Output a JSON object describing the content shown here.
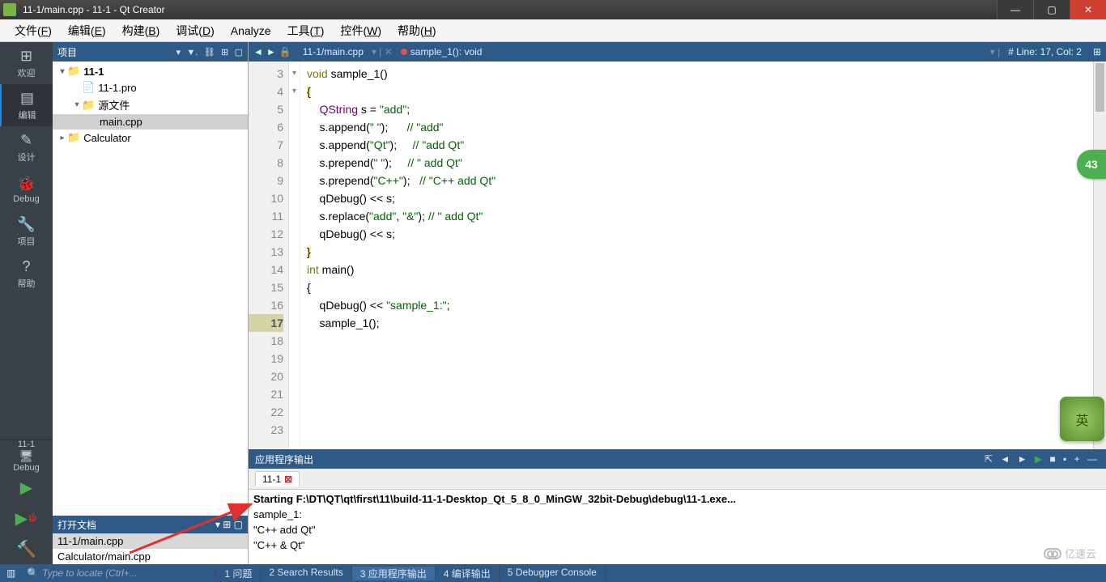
{
  "window": {
    "title": "11-1/main.cpp - 11-1 - Qt Creator"
  },
  "menus": [
    "文件(F)",
    "编辑(E)",
    "构建(B)",
    "调试(D)",
    "Analyze",
    "工具(T)",
    "控件(W)",
    "帮助(H)"
  ],
  "leftbar": {
    "items": [
      {
        "icon": "⊞",
        "label": "欢迎"
      },
      {
        "icon": "▤",
        "label": "编辑",
        "active": true
      },
      {
        "icon": "✎",
        "label": "设计"
      },
      {
        "icon": "🐞",
        "label": "Debug"
      },
      {
        "icon": "🔧",
        "label": "项目"
      },
      {
        "icon": "?",
        "label": "帮助"
      }
    ],
    "kit": {
      "name": "11-1",
      "mode": "Debug",
      "monitor": "🖥"
    }
  },
  "project_pane": {
    "title": "项目",
    "tree": [
      {
        "indent": 0,
        "arrow": "▾",
        "icon": "📁",
        "label": "11-1",
        "bold": true
      },
      {
        "indent": 1,
        "arrow": "",
        "icon": "📄",
        "label": "11-1.pro"
      },
      {
        "indent": 1,
        "arrow": "▾",
        "icon": "📁",
        "label": "源文件"
      },
      {
        "indent": 2,
        "arrow": "",
        "icon": "",
        "label": "main.cpp",
        "sel": true
      },
      {
        "indent": 0,
        "arrow": "▸",
        "icon": "📁",
        "label": "Calculator"
      }
    ]
  },
  "open_docs": {
    "title": "打开文档",
    "items": [
      {
        "label": "11-1/main.cpp",
        "sel": true
      },
      {
        "label": "Calculator/main.cpp"
      }
    ]
  },
  "editor": {
    "file": "11-1/main.cpp",
    "func": "sample_1(): void",
    "pos": "# Line: 17, Col: 2",
    "first_line": 3,
    "current_line": 17
  },
  "output_panel": {
    "title": "应用程序输出",
    "tab": "11-1",
    "lines": [
      "Starting F:\\DT\\QT\\qt\\first\\11\\build-11-1-Desktop_Qt_5_8_0_MinGW_32bit-Debug\\debug\\11-1.exe...",
      "sample_1:",
      "\"C++ add Qt\"",
      "\"C++ & Qt\""
    ]
  },
  "status": {
    "search_placeholder": "Type to locate (Ctrl+...",
    "tabs": [
      "1 问题",
      "2 Search Results",
      "3 应用程序输出",
      "4 编译输出",
      "5 Debugger Console"
    ],
    "active": 2
  },
  "badge": "43",
  "ime": "英",
  "watermark": "亿速云"
}
